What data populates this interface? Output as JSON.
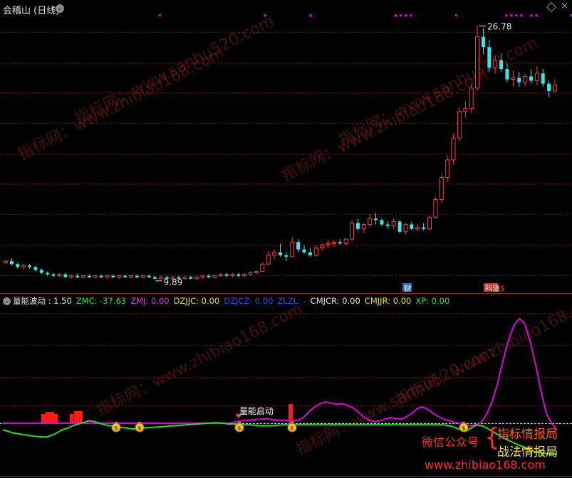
{
  "header": {
    "title": "会稽山 (日线)",
    "dropdown_icon": "chevron-down-icon",
    "right_icons": [
      "diamond-icon",
      "close-icon"
    ]
  },
  "price_panel": {
    "high_label": "26.78",
    "low_label": "9.89",
    "event_markers": [
      {
        "label": "财",
        "color": "#2a6fbf"
      },
      {
        "label": "科涨",
        "color": "#c0392b"
      },
      {
        "label": "$",
        "color": "#ff2a2a"
      }
    ]
  },
  "indicator_bar": {
    "name": "量能波动",
    "items": [
      {
        "label": "量能波动 : 1.50",
        "color": "#e6e6e6"
      },
      {
        "label": "ZMC: -37.63",
        "color": "#35e035"
      },
      {
        "label": "ZMJ: 0.00",
        "color": "#e040e0"
      },
      {
        "label": "DZJJC: 0.00",
        "color": "#f2e600"
      },
      {
        "label": "DZJCZ: 0.00",
        "color": "#3a4cff"
      },
      {
        "label": "ZLZL: -",
        "color": "#3a4cff"
      },
      {
        "label": "CMJCR: 0.00",
        "color": "#e6e6e6"
      },
      {
        "label": "CMJJR: 0.00",
        "color": "#f2e600"
      },
      {
        "label": "XP: 0.00",
        "color": "#35e035"
      }
    ]
  },
  "indicator_panel": {
    "annotation": "量能启动",
    "marker_icon": "money-bag-icon"
  },
  "watermarks": [
    "指标网：www.zhibiao168.com",
    "指标网：www.sanhu520.com",
    "指标网：www.zhibiao168.com",
    "指标网：www.sanhu520.com"
  ],
  "promo": {
    "wechat_label": "微信公众号",
    "line1": "指标情报局",
    "line2": "战法情报局",
    "site": "www.zhibiao168.com"
  },
  "colors": {
    "up": "#ff3b3b",
    "down": "#44e0e8",
    "grid": "#7a1010",
    "signal_dots": "#e000e0",
    "zmj_line": "#e000e0",
    "zmc_line": "#20e020",
    "baseline": "#e6e600",
    "volume_bars": "#ff1a1a"
  },
  "chart_data": [
    {
      "type": "candlestick",
      "title": "会稽山 (日线)",
      "high": 26.78,
      "low": 9.89,
      "ohlc": [
        [
          10.6,
          10.8,
          10.5,
          10.7
        ],
        [
          10.7,
          10.9,
          10.4,
          10.5
        ],
        [
          10.5,
          10.6,
          10.2,
          10.3
        ],
        [
          10.3,
          10.5,
          10.1,
          10.4
        ],
        [
          10.4,
          10.5,
          10.2,
          10.3
        ],
        [
          10.3,
          10.4,
          10.0,
          10.1
        ],
        [
          10.1,
          10.2,
          9.8,
          9.9
        ],
        [
          9.9,
          10.0,
          9.7,
          9.8
        ],
        [
          9.8,
          9.9,
          9.6,
          9.7
        ],
        [
          9.7,
          9.9,
          9.6,
          9.8
        ],
        [
          9.8,
          9.9,
          9.55,
          9.6
        ],
        [
          9.6,
          9.75,
          9.5,
          9.7
        ],
        [
          9.7,
          9.85,
          9.55,
          9.6
        ],
        [
          9.6,
          9.75,
          9.5,
          9.7
        ],
        [
          9.7,
          9.8,
          9.55,
          9.6
        ],
        [
          9.6,
          9.75,
          9.5,
          9.7
        ],
        [
          9.7,
          9.8,
          9.55,
          9.6
        ],
        [
          9.6,
          9.75,
          9.5,
          9.7
        ],
        [
          9.7,
          9.8,
          9.55,
          9.6
        ],
        [
          9.6,
          9.75,
          9.5,
          9.7
        ],
        [
          9.7,
          9.8,
          9.55,
          9.6
        ],
        [
          9.6,
          9.75,
          9.5,
          9.7
        ],
        [
          9.7,
          9.8,
          9.55,
          9.6
        ],
        [
          9.6,
          9.75,
          9.5,
          9.7
        ],
        [
          9.7,
          9.8,
          9.55,
          9.6
        ],
        [
          9.6,
          9.7,
          9.45,
          9.5
        ],
        [
          9.5,
          9.7,
          9.45,
          9.6
        ],
        [
          9.6,
          9.7,
          9.45,
          9.5
        ],
        [
          9.5,
          9.7,
          9.45,
          9.6
        ],
        [
          9.6,
          9.7,
          9.45,
          9.5
        ],
        [
          9.5,
          9.7,
          9.45,
          9.6
        ],
        [
          9.6,
          9.7,
          9.45,
          9.5
        ],
        [
          9.5,
          9.7,
          9.45,
          9.6
        ],
        [
          9.6,
          9.75,
          9.5,
          9.7
        ],
        [
          9.7,
          9.8,
          9.55,
          9.6
        ],
        [
          9.6,
          9.75,
          9.5,
          9.7
        ],
        [
          9.7,
          9.9,
          9.6,
          9.8
        ],
        [
          9.8,
          9.9,
          9.6,
          9.7
        ],
        [
          9.7,
          9.9,
          9.6,
          9.8
        ],
        [
          9.8,
          9.9,
          9.6,
          9.7
        ],
        [
          9.7,
          9.9,
          9.6,
          9.8
        ],
        [
          9.8,
          10.0,
          9.7,
          9.9
        ],
        [
          9.9,
          10.1,
          9.8,
          10.0
        ],
        [
          10.0,
          10.6,
          10.0,
          10.5
        ],
        [
          10.5,
          11.4,
          10.4,
          11.1
        ],
        [
          11.1,
          11.5,
          10.8,
          11.3
        ],
        [
          11.3,
          11.9,
          11.0,
          11.1
        ],
        [
          11.1,
          11.3,
          10.7,
          11.0
        ],
        [
          11.0,
          12.3,
          11.0,
          12.0
        ],
        [
          12.0,
          12.2,
          11.3,
          11.5
        ],
        [
          11.5,
          11.8,
          11.2,
          11.3
        ],
        [
          11.3,
          11.6,
          11.0,
          11.1
        ],
        [
          11.1,
          11.8,
          11.0,
          11.6
        ],
        [
          11.6,
          11.9,
          11.4,
          11.8
        ],
        [
          11.8,
          12.1,
          11.6,
          11.9
        ],
        [
          11.9,
          12.1,
          11.7,
          12.0
        ],
        [
          12.0,
          12.2,
          11.8,
          11.9
        ],
        [
          11.9,
          12.3,
          11.8,
          12.2
        ],
        [
          12.2,
          13.5,
          12.1,
          13.3
        ],
        [
          13.3,
          13.6,
          12.8,
          12.9
        ],
        [
          12.9,
          13.3,
          12.6,
          13.2
        ],
        [
          13.2,
          13.9,
          13.0,
          13.6
        ],
        [
          13.6,
          14.0,
          13.2,
          13.5
        ],
        [
          13.5,
          13.6,
          13.1,
          13.2
        ],
        [
          13.2,
          13.4,
          12.9,
          13.1
        ],
        [
          13.1,
          13.6,
          12.9,
          13.4
        ],
        [
          13.4,
          13.5,
          12.6,
          12.7
        ],
        [
          12.7,
          13.3,
          12.5,
          13.2
        ],
        [
          13.2,
          13.4,
          12.8,
          12.9
        ],
        [
          12.9,
          13.2,
          12.7,
          13.0
        ],
        [
          13.0,
          13.3,
          12.8,
          12.9
        ],
        [
          12.9,
          13.8,
          12.8,
          13.7
        ],
        [
          13.7,
          15.1,
          13.6,
          14.9
        ],
        [
          14.9,
          16.6,
          14.7,
          16.4
        ],
        [
          16.4,
          17.9,
          16.1,
          17.6
        ],
        [
          17.6,
          19.4,
          17.3,
          19.1
        ],
        [
          19.1,
          21.2,
          18.9,
          20.9
        ],
        [
          20.9,
          21.6,
          20.5,
          21.1
        ],
        [
          21.1,
          22.8,
          20.8,
          22.5
        ],
        [
          22.5,
          26.78,
          22.3,
          26.0
        ],
        [
          26.0,
          26.6,
          24.8,
          25.3
        ],
        [
          25.3,
          25.8,
          23.6,
          23.9
        ],
        [
          23.9,
          24.7,
          23.5,
          24.4
        ],
        [
          24.4,
          24.9,
          23.6,
          23.8
        ],
        [
          23.8,
          24.2,
          22.9,
          23.1
        ],
        [
          23.1,
          23.7,
          22.6,
          23.2
        ],
        [
          23.2,
          23.6,
          22.6,
          22.9
        ],
        [
          22.9,
          23.5,
          22.6,
          23.3
        ],
        [
          23.3,
          23.8,
          22.8,
          23.0
        ],
        [
          23.0,
          24.0,
          22.7,
          23.5
        ],
        [
          23.5,
          23.8,
          22.6,
          22.8
        ],
        [
          22.8,
          23.0,
          21.9,
          22.3
        ],
        [
          22.3,
          23.1,
          22.2,
          22.7
        ]
      ]
    },
    {
      "type": "line",
      "series": [
        {
          "name": "ZMJ",
          "values": [
            0,
            0,
            0,
            0,
            0,
            0,
            0,
            0,
            0,
            0,
            0,
            0,
            0,
            0,
            0,
            0,
            0,
            0,
            0,
            0,
            0,
            0,
            0,
            0,
            0,
            0,
            0,
            0,
            0,
            0,
            0,
            0,
            0,
            0,
            0,
            0,
            0,
            0,
            0,
            0,
            0,
            0,
            0,
            1.5,
            2.5,
            3.5,
            4.0,
            4.5,
            5.0,
            5.5,
            4.5,
            4.0,
            3.5,
            3.0,
            2.5,
            4.0,
            8.0,
            15.0,
            20.0,
            24.0,
            26.0,
            25.0,
            23.0,
            24.0,
            22.0,
            19.0,
            14.0,
            8.0,
            4.0,
            2.0,
            3.0,
            5.0,
            7.0,
            6.0,
            5.0,
            8.0,
            12.0,
            18.0,
            20.0,
            17.0,
            12.0,
            8.0,
            5.0,
            3.0,
            1.0,
            0,
            -2.0,
            -3.0,
            -1.5,
            2.0,
            12.0,
            28.0,
            50.0,
            78.0,
            102.0,
            120.0,
            128.0,
            122.0,
            100.0,
            72.0,
            40.0,
            12.0,
            0,
            -8.0
          ]
        },
        {
          "name": "ZMC",
          "values": [
            -8.0,
            -10.0,
            -12.0,
            -13.0,
            -14.0,
            -15.0,
            -16.0,
            -16.5,
            -17.0,
            -15.0,
            -12.0,
            -8.0,
            -6.0,
            -3.0,
            -1.0,
            1.0,
            3.0,
            2.0,
            0,
            -2.0,
            -3.0,
            -4.0,
            -5.0,
            -6.0,
            -7.0,
            -7.0,
            -6.0,
            -5.5,
            -5.0,
            -4.5,
            -4.0,
            -3.5,
            -3.0,
            -2.5,
            -2.0,
            -1.5,
            -1.0,
            -0.5,
            0,
            0.5,
            0.5,
            0,
            -1.0,
            -1.0,
            -1.5,
            -2.0,
            -2.0,
            -2.5,
            -3.0,
            -3.0,
            -3.0,
            -2.5,
            -2.0,
            -2.0,
            -2.0,
            -2.0,
            -2.0,
            -2.0,
            -2.0,
            -2.0,
            -2.0,
            -2.0,
            -2.0,
            -2.0,
            -2.0,
            -2.0,
            -2.0,
            -2.0,
            -2.0,
            -2.0,
            -2.0,
            -2.0,
            -2.0,
            -2.0,
            -2.0,
            -2.0,
            -2.0,
            -2.0,
            -2.0,
            -2.0,
            -2.0,
            -2.0,
            -2.0,
            -3.0,
            -5.0,
            -8.0,
            -10.0,
            -6.0,
            -2.0,
            -3.0,
            -6.0,
            -10.0,
            -14.0,
            -18.0,
            -21.0,
            -24.0,
            -27.0,
            -30.0,
            -33.0,
            -35.0,
            -36.0,
            -37.0,
            -37.63,
            -37.63
          ]
        }
      ]
    }
  ]
}
